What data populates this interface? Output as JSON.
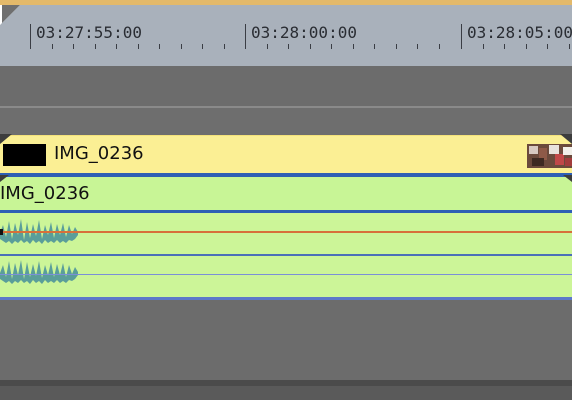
{
  "ruler": {
    "timecodes": [
      "03:27:55:00",
      "03:28:00:00",
      "03:28:05:00"
    ]
  },
  "video_track": {
    "event_name": "IMG_0236",
    "color": "#fbef94"
  },
  "audio_track": {
    "event_name": "IMG_0236",
    "color": "#ccf598",
    "volume_line_color": "#d7703a",
    "waveform_color": "#5a9e9a"
  },
  "icons": {
    "corner": "corner-notch-icon",
    "fade_handle": "fade-handle-icon"
  }
}
